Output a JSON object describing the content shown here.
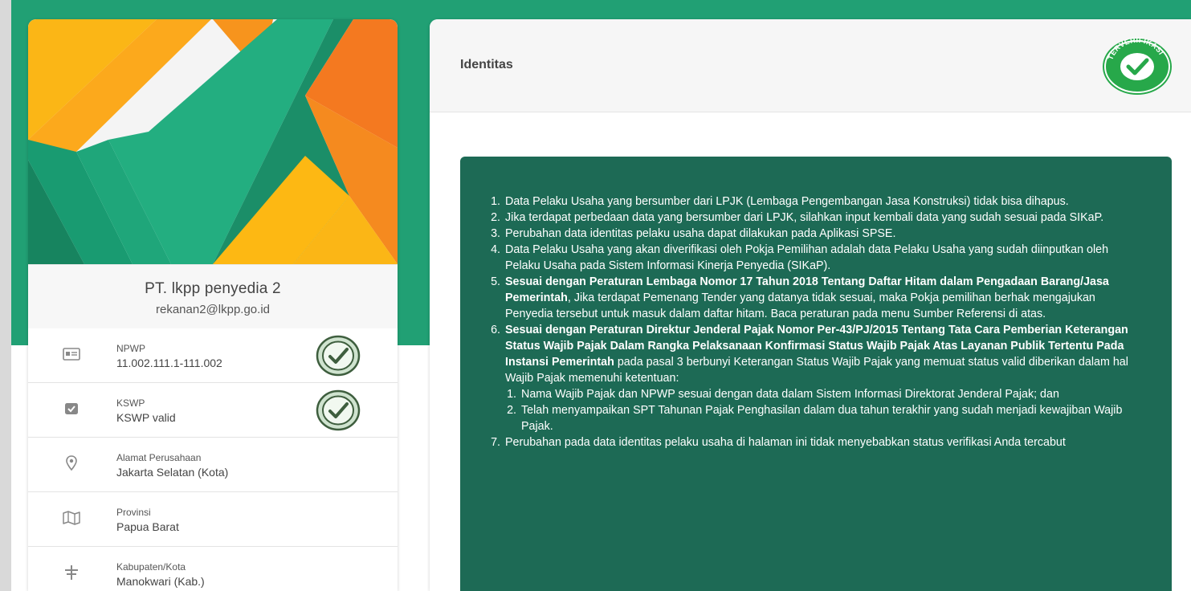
{
  "profile": {
    "company_name": "PT. lkpp penyedia 2",
    "email": "rekanan2@lkpp.go.id"
  },
  "info_items": [
    {
      "label": "NPWP",
      "value": "11.002.111.1-111.002",
      "icon": "id-card-icon",
      "verified": true
    },
    {
      "label": "KSWP",
      "value": "KSWP valid",
      "icon": "check-square-icon",
      "verified": true
    },
    {
      "label": "Alamat Perusahaan",
      "value": "Jakarta Selatan (Kota)",
      "icon": "map-pin-icon",
      "verified": false
    },
    {
      "label": "Provinsi",
      "value": "Papua Barat",
      "icon": "map-icon",
      "verified": false
    },
    {
      "label": "Kabupaten/Kota",
      "value": "Manokwari (Kab.)",
      "icon": "signpost-icon",
      "verified": false
    }
  ],
  "panel": {
    "title": "Identitas",
    "badge_text": "TERVERIFIKASI"
  },
  "notice": {
    "items": [
      {
        "text": "Data Pelaku Usaha yang bersumber dari LPJK (Lembaga Pengembangan Jasa Konstruksi) tidak bisa dihapus."
      },
      {
        "text": "Jika terdapat perbedaan data yang bersumber dari LPJK, silahkan input kembali data yang sudah sesuai pada SIKaP."
      },
      {
        "text": "Perubahan data identitas pelaku usaha dapat dilakukan pada Aplikasi SPSE."
      },
      {
        "text": "Data Pelaku Usaha yang akan diverifikasi oleh Pokja Pemilihan adalah data Pelaku Usaha yang sudah diinputkan oleh Pelaku Usaha pada Sistem Informasi Kinerja Penyedia (SIKaP)."
      },
      {
        "bold": "Sesuai dengan Peraturan Lembaga Nomor 17 Tahun 2018 Tentang Daftar Hitam dalam Pengadaan Barang/Jasa Pemerintah",
        "text": ", Jika terdapat Pemenang Tender yang datanya tidak sesuai, maka Pokja pemilihan berhak mengajukan Penyedia tersebut untuk masuk dalam daftar hitam. Baca peraturan pada menu Sumber Referensi di atas."
      },
      {
        "bold": "Sesuai dengan Peraturan Direktur Jenderal Pajak Nomor Per-43/PJ/2015 Tentang Tata Cara Pemberian Keterangan Status Wajib Pajak Dalam Rangka Pelaksanaan Konfirmasi Status Wajib Pajak Atas Layanan Publik Tertentu Pada Instansi Pemerintah",
        "text": " pada pasal 3 berbunyi Keterangan Status Wajib Pajak yang memuat status valid diberikan dalam hal Wajib Pajak memenuhi ketentuan:",
        "sub": [
          "Nama Wajib Pajak dan NPWP sesuai dengan data dalam Sistem Informasi Direktorat Jenderal Pajak; dan",
          "Telah menyampaikan SPT Tahunan Pajak Penghasilan dalam dua tahun terakhir yang sudah menjadi kewajiban Wajib Pajak."
        ]
      },
      {
        "text": "Perubahan pada data identitas pelaku usaha di halaman ini tidak menyebabkan status verifikasi Anda tercabut"
      }
    ]
  },
  "colors": {
    "brand_green": "#21a074",
    "notice_green": "#1d6a55",
    "logo_orange": "#f7941d",
    "logo_yellow": "#fbb616"
  }
}
